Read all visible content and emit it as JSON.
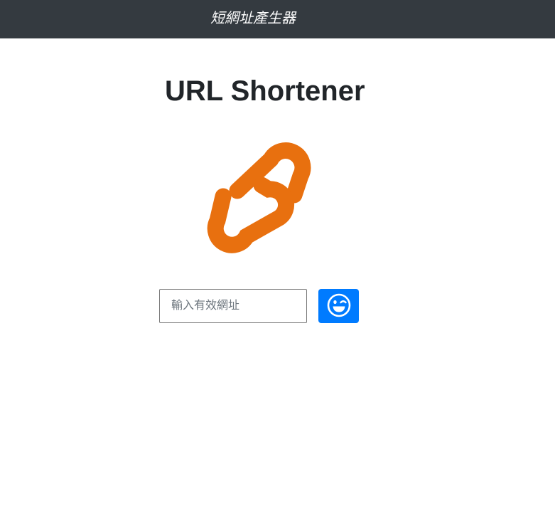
{
  "navbar": {
    "brand": "短網址產生器"
  },
  "main": {
    "title": "URL Shortener",
    "logo_icon": "link-icon",
    "logo_color": "#e8700f"
  },
  "form": {
    "url_input": {
      "placeholder": "輸入有效網址",
      "value": ""
    },
    "submit_button": {
      "icon": "grin-wink-icon",
      "color": "#007bff"
    }
  }
}
